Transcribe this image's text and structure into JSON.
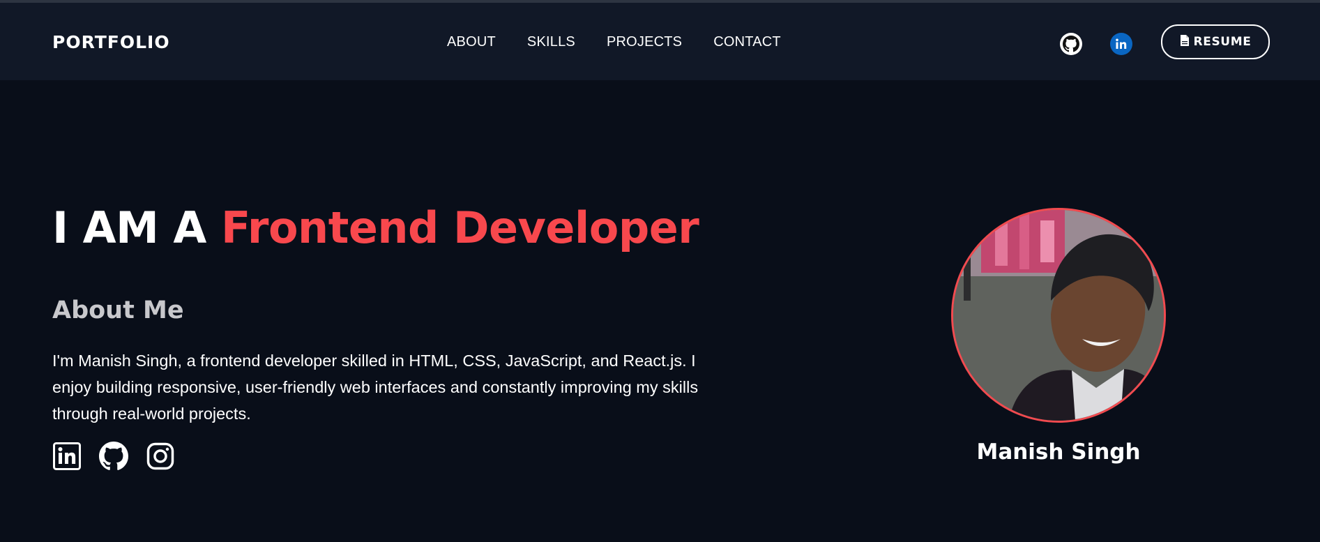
{
  "header": {
    "brand": "PORTFOLIO",
    "nav": [
      "ABOUT",
      "SKILLS",
      "PROJECTS",
      "CONTACT"
    ],
    "icons": [
      "github-icon",
      "linkedin-icon"
    ],
    "resume_label": "RESUME"
  },
  "hero": {
    "title_prefix": "I AM A ",
    "title_highlight": "Frontend Developer",
    "about_heading": "About Me",
    "about_text": "I'm Manish Singh, a frontend developer skilled in HTML, CSS, JavaScript, and React.js. I enjoy building responsive, user-friendly web interfaces and constantly improving my skills through real-world projects.",
    "social_icons": [
      "linkedin-icon",
      "github-icon",
      "instagram-icon"
    ]
  },
  "profile": {
    "name": "Manish Singh"
  },
  "colors": {
    "background": "#090e19",
    "header": "#111827",
    "accent": "#f8484d",
    "linkedin": "#0a66c2"
  }
}
